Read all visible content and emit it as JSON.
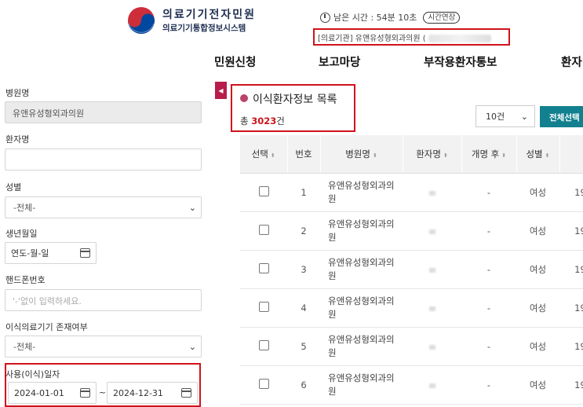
{
  "header": {
    "logo_title": "의료기기전자민원",
    "logo_subtitle": "의료기기통합정보시스템",
    "timer_text": "남은 시간 : 54분 10초",
    "extend_label": "시간연장",
    "org_text": "[의료기관] 유앤유성형외과의원 ("
  },
  "nav": [
    "민원신청",
    "보고마당",
    "부작용환자통보",
    "환자"
  ],
  "filters": {
    "hospital_label": "병원명",
    "hospital_value": "유앤유성형외과의원",
    "patient_label": "환자명",
    "patient_value": "",
    "gender_label": "성별",
    "gender_value": "-전체-",
    "birth_label": "생년월일",
    "birth_placeholder": "연도-월-일",
    "phone_label": "핸드폰번호",
    "phone_placeholder": "'-'없이 입력하세요.",
    "implant_label": "이식의료기기 존재여부",
    "implant_value": "-전체-",
    "use_date_label": "사용(이식)일자",
    "date_from": "2024-01-01",
    "date_to": "2024-12-31",
    "tilde": "~"
  },
  "list": {
    "title": "이식환자정보 목록",
    "total_prefix": "총 ",
    "total_count": "3023",
    "total_suffix": "건",
    "page_size": "10건",
    "select_all": "전체선택"
  },
  "table": {
    "columns": [
      "선택",
      "번호",
      "병원명",
      "환자명",
      "개명 후",
      "성별",
      ""
    ],
    "rows": [
      {
        "no": "1",
        "hospital": "유앤유성형외과의원",
        "renamed": "-",
        "gender": "여성",
        "extra": "19"
      },
      {
        "no": "2",
        "hospital": "유앤유성형외과의원",
        "renamed": "-",
        "gender": "여성",
        "extra": "19"
      },
      {
        "no": "3",
        "hospital": "유앤유성형외과의원",
        "renamed": "-",
        "gender": "여성",
        "extra": "19"
      },
      {
        "no": "4",
        "hospital": "유앤유성형외과의원",
        "renamed": "-",
        "gender": "여성",
        "extra": "19"
      },
      {
        "no": "5",
        "hospital": "유앤유성형외과의원",
        "renamed": "-",
        "gender": "여성",
        "extra": "19"
      },
      {
        "no": "6",
        "hospital": "유앤유성형외과의원",
        "renamed": "-",
        "gender": "여성",
        "extra": "19"
      }
    ]
  },
  "colors": {
    "accent_red": "#d0121b",
    "teal_button": "#12808e",
    "tab_magenta": "#b71c4a"
  }
}
